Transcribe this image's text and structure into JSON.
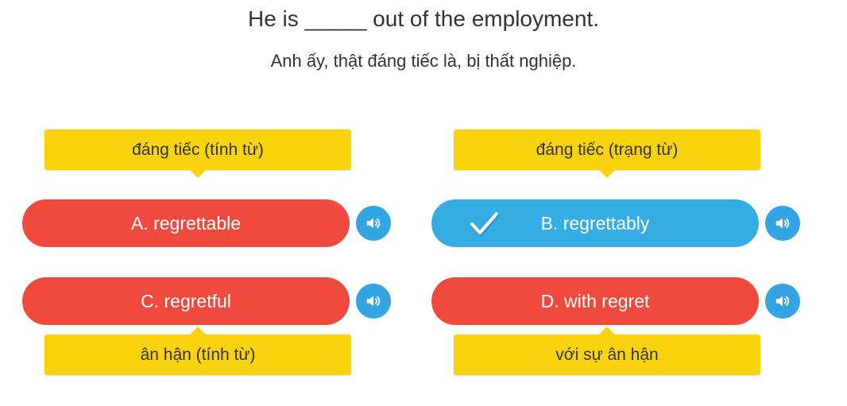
{
  "question": "He is _____ out of the employment.",
  "translation": "Anh ấy, thật đáng tiếc là, bị thất nghiệp.",
  "options": [
    {
      "label": "A. regrettable",
      "hint": "đáng tiếc (tính từ)",
      "state": "wrong"
    },
    {
      "label": "B. regrettably",
      "hint": "đáng tiếc (trạng từ)",
      "state": "selected"
    },
    {
      "label": "C. regretful",
      "hint": "ân hận (tính từ)",
      "state": "wrong"
    },
    {
      "label": "D. with regret",
      "hint": "với sự ân hận",
      "state": "wrong"
    }
  ],
  "icons": {
    "audio": "speaker-icon",
    "selected": "check-icon"
  },
  "colors": {
    "wrong": "#ef4a3d",
    "selected": "#35ace2",
    "hint": "#f9d30d",
    "audio": "#35a4e3"
  }
}
